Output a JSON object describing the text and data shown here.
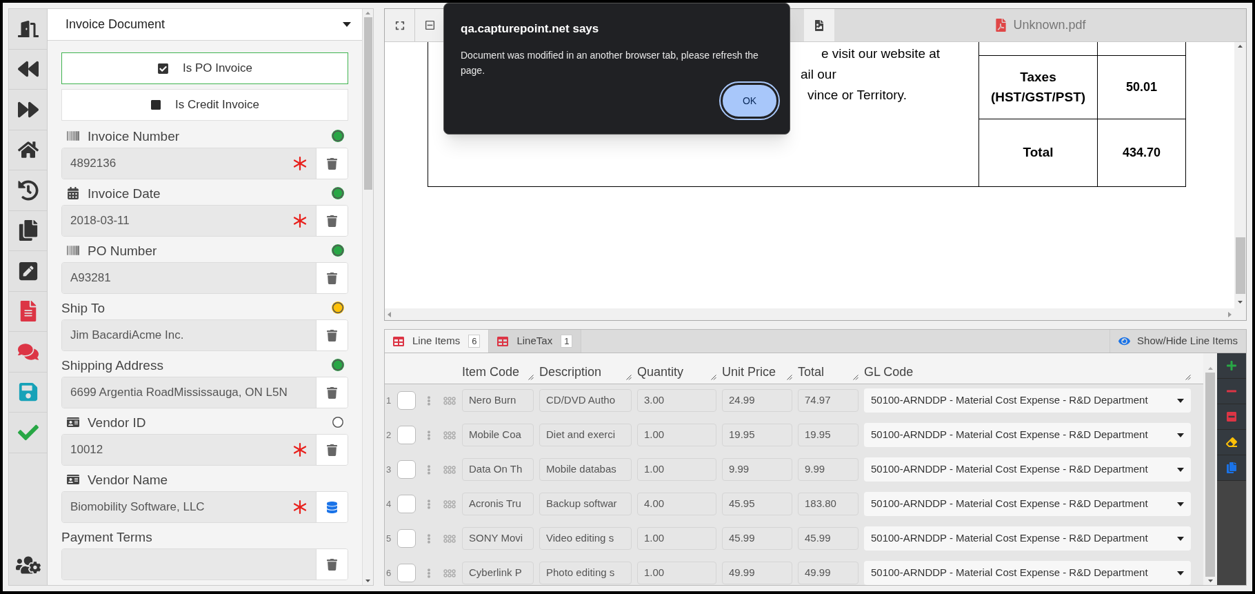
{
  "panel": {
    "title": "Invoice Document",
    "toggles": [
      {
        "label": "Is PO Invoice",
        "checked": true
      },
      {
        "label": "Is Credit Invoice",
        "checked": false
      }
    ],
    "fields": [
      {
        "label": "Invoice Number",
        "kind": "barcode",
        "color": "#28a745",
        "value": "4892136",
        "required": true,
        "lookup": false
      },
      {
        "label": "Invoice Date",
        "kind": "date",
        "color": "#28a745",
        "value": "2018-03-11",
        "required": true,
        "lookup": false
      },
      {
        "label": "PO Number",
        "kind": "barcode",
        "color": "#28a745",
        "value": "A93281",
        "required": false,
        "lookup": false
      },
      {
        "label": "Ship To",
        "kind": "plain",
        "color": "#ffc107",
        "value": "Jim BacardiAcme Inc.",
        "required": false,
        "lookup": false
      },
      {
        "label": "Shipping Address",
        "kind": "plain",
        "color": "#28a745",
        "value": "6699 Argentia RoadMississauga, ON L5N",
        "required": false,
        "lookup": false
      },
      {
        "label": "Vendor ID",
        "kind": "vendor",
        "color": "#ffffff",
        "value": "10012",
        "required": true,
        "lookup": false
      },
      {
        "label": "Vendor Name",
        "kind": "vendor",
        "value": "Biomobility Software, LLC",
        "required": true,
        "lookup": true
      },
      {
        "label": "Payment Terms",
        "kind": "plain",
        "required": false,
        "lookup": false
      }
    ]
  },
  "viewer": {
    "tab": "Unknown.pdf",
    "document_lines": [
      "e visit our website at",
      "ail our",
      "vince or Territory."
    ],
    "totals": [
      {
        "label": "Taxes (HST/GST/PST)",
        "value": "50.01"
      },
      {
        "label": "Total",
        "value": "434.70"
      }
    ]
  },
  "dialog": {
    "title": "qa.capturepoint.net says",
    "message": "Document was modified in an another browser tab, please refresh the page.",
    "button": "OK"
  },
  "line_items": {
    "tabs": [
      {
        "label": "Line Items",
        "count": "6",
        "selected": true
      },
      {
        "label": "LineTax",
        "count": "1",
        "selected": false
      }
    ],
    "show_hide": "Show/Hide Line Items",
    "columns": [
      "Item Code",
      "Description",
      "Quantity",
      "Unit Price",
      "Total",
      "GL Code"
    ],
    "rows": [
      {
        "number": "1",
        "checked": false,
        "cells": [
          "Nero Burn",
          "CD/DVD Autho",
          "3.00",
          "24.99",
          "74.97"
        ],
        "gl_code": "50100-ARNDDP - Material Cost Expense - R&D Department"
      },
      {
        "number": "2",
        "checked": false,
        "cells": [
          "Mobile Coa",
          "Diet and exerci",
          "1.00",
          "19.95",
          "19.95"
        ],
        "gl_code": "50100-ARNDDP - Material Cost Expense - R&D Department"
      },
      {
        "number": "3",
        "checked": false,
        "cells": [
          "Data On Th",
          "Mobile databas",
          "1.00",
          "9.99",
          "9.99"
        ],
        "gl_code": "50100-ARNDDP - Material Cost Expense - R&D Department"
      },
      {
        "number": "4",
        "checked": false,
        "cells": [
          "Acronis Tru",
          "Backup softwar",
          "4.00",
          "45.95",
          "183.80"
        ],
        "gl_code": "50100-ARNDDP - Material Cost Expense - R&D Department"
      },
      {
        "number": "5",
        "checked": false,
        "cells": [
          "SONY Movi",
          "Video editing s",
          "1.00",
          "45.99",
          "45.99"
        ],
        "gl_code": "50100-ARNDDP - Material Cost Expense - R&D Department"
      },
      {
        "number": "6",
        "checked": false,
        "cells": [
          "Cyberlink P",
          "Photo editing s",
          "1.00",
          "49.99",
          "49.99"
        ],
        "gl_code": "50100-ARNDDP - Material Cost Expense - R&D Department"
      }
    ]
  }
}
